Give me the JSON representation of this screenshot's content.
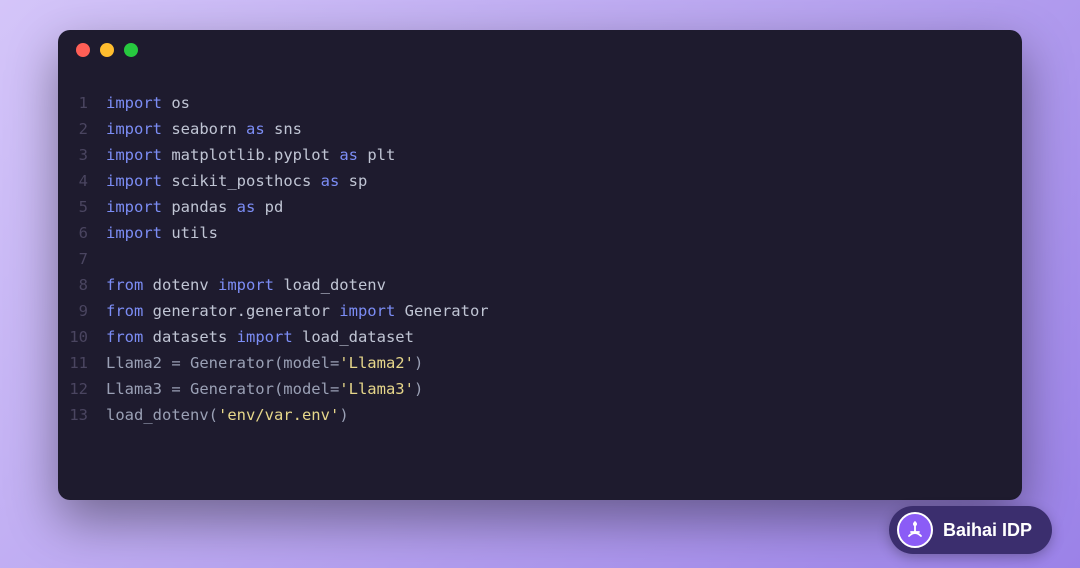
{
  "window": {
    "dots": [
      "red",
      "yellow",
      "green"
    ]
  },
  "code": {
    "lines": [
      {
        "n": "1",
        "tokens": [
          [
            "kw",
            "import"
          ],
          [
            "text",
            " os"
          ]
        ]
      },
      {
        "n": "2",
        "tokens": [
          [
            "kw",
            "import"
          ],
          [
            "text",
            " seaborn "
          ],
          [
            "kw",
            "as"
          ],
          [
            "text",
            " sns"
          ]
        ]
      },
      {
        "n": "3",
        "tokens": [
          [
            "kw",
            "import"
          ],
          [
            "text",
            " matplotlib.pyplot "
          ],
          [
            "kw",
            "as"
          ],
          [
            "text",
            " plt"
          ]
        ]
      },
      {
        "n": "4",
        "tokens": [
          [
            "kw",
            "import"
          ],
          [
            "text",
            " scikit_posthocs "
          ],
          [
            "kw",
            "as"
          ],
          [
            "text",
            " sp"
          ]
        ]
      },
      {
        "n": "5",
        "tokens": [
          [
            "kw",
            "import"
          ],
          [
            "text",
            " pandas "
          ],
          [
            "kw",
            "as"
          ],
          [
            "text",
            " pd"
          ]
        ]
      },
      {
        "n": "6",
        "tokens": [
          [
            "kw",
            "import"
          ],
          [
            "text",
            " utils"
          ]
        ]
      },
      {
        "n": "7",
        "tokens": []
      },
      {
        "n": "8",
        "tokens": [
          [
            "kw",
            "from"
          ],
          [
            "text",
            " dotenv "
          ],
          [
            "kw",
            "import"
          ],
          [
            "text",
            " load_dotenv"
          ]
        ]
      },
      {
        "n": "9",
        "tokens": [
          [
            "kw",
            "from"
          ],
          [
            "text",
            " generator.generator "
          ],
          [
            "kw",
            "import"
          ],
          [
            "text",
            " Generator"
          ]
        ]
      },
      {
        "n": "10",
        "tokens": [
          [
            "kw",
            "from"
          ],
          [
            "text",
            " datasets "
          ],
          [
            "kw",
            "import"
          ],
          [
            "text",
            " load_dataset"
          ]
        ]
      },
      {
        "n": "11",
        "tokens": [
          [
            "pale",
            "Llama2 = Generator(model="
          ],
          [
            "str",
            "'Llama2'"
          ],
          [
            "pale",
            ")"
          ]
        ]
      },
      {
        "n": "12",
        "tokens": [
          [
            "pale",
            "Llama3 = Generator(model="
          ],
          [
            "str",
            "'Llama3'"
          ],
          [
            "pale",
            ")"
          ]
        ]
      },
      {
        "n": "13",
        "tokens": [
          [
            "pale",
            "load_dotenv("
          ],
          [
            "str",
            "'env/var.env'"
          ],
          [
            "pale",
            ")"
          ]
        ]
      }
    ]
  },
  "badge": {
    "label": "Baihai IDP"
  }
}
